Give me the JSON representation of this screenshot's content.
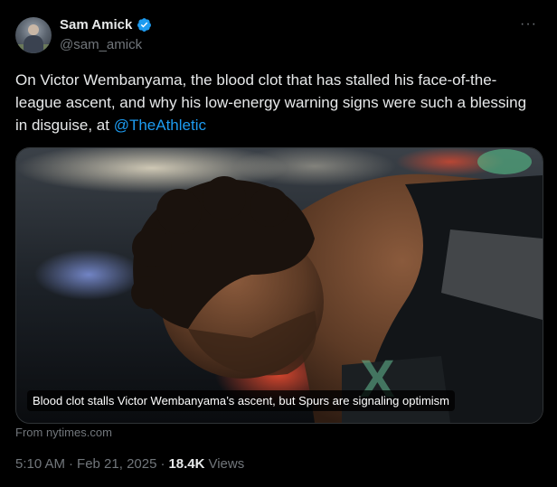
{
  "author": {
    "display_name": "Sam Amick",
    "handle": "@sam_amick",
    "verified_icon": "verified-badge-icon",
    "avatar_icon": "avatar-photo",
    "more_icon": "more-options-icon"
  },
  "tweet": {
    "text_main": "On Victor Wembanyama, the blood clot that has stalled his face-of-the-league ascent, and why his low-energy warning signs were such a blessing in disguise, at ",
    "mention": "@TheAthletic"
  },
  "card": {
    "caption": "Blood clot stalls Victor Wembanyama’s ascent, but Spurs are signaling optimism",
    "source": "From nytimes.com"
  },
  "meta": {
    "time": "5:10 AM",
    "date": "Feb 21, 2025",
    "sep": "·",
    "views_count": "18.4K",
    "views_label": "Views"
  },
  "colors": {
    "background": "#000000",
    "text": "#e7e9ea",
    "muted": "#71767b",
    "accent": "#1d9bf0"
  }
}
